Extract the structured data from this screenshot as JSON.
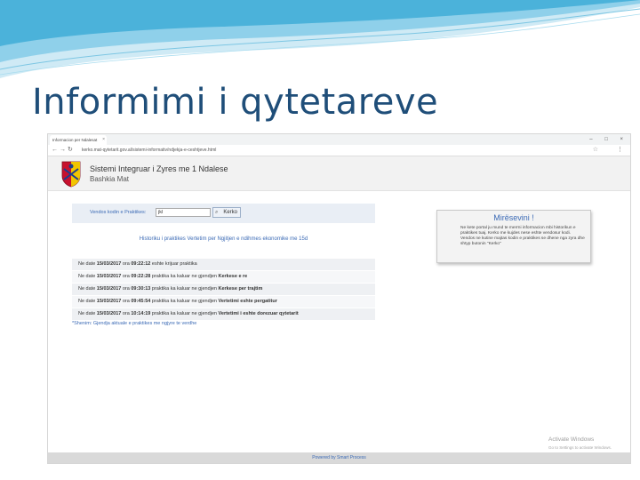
{
  "slide": {
    "title": "Informimi i qytetareve"
  },
  "browser": {
    "tab_title": "Informacion per Ndalesat",
    "tab_close": "×",
    "url": "kerko.mat-qytetarit.gov.al/sistemi-informativ/ndjekja-e-ceshtjeve.html",
    "window_controls": "– □ ×"
  },
  "site": {
    "title": "Sistemi Integruar i Zyres me 1 Ndalese",
    "subtitle": "Bashkia Mat"
  },
  "search": {
    "label": "Vendos kodin e Praktikes:",
    "value": "jkl",
    "button": "Kerko"
  },
  "results": {
    "note": "Historiku i praktikes Vertetim per Ngjitjen e ndihmes ekonomike me 15d",
    "rows": [
      {
        "prefix": "Ne date ",
        "date": "15/03/2017",
        "mid": " ora ",
        "time": "09:22:12",
        "text": " eshte krijuar praktika",
        "status": ""
      },
      {
        "prefix": "Ne date ",
        "date": "15/03/2017",
        "mid": " ora ",
        "time": "09:22:28",
        "text": " praktika ka kaluar ne gjendjen ",
        "status": "Kerkese e re"
      },
      {
        "prefix": "Ne date ",
        "date": "15/03/2017",
        "mid": " ora ",
        "time": "09:30:13",
        "text": " praktika ka kaluar ne gjendjen ",
        "status": "Kerkese per trajtim"
      },
      {
        "prefix": "Ne date ",
        "date": "15/03/2017",
        "mid": " ora ",
        "time": "09:45:54",
        "text": " praktika ka kaluar ne gjendjen ",
        "status": "Vertetimi eshte pergatitur"
      },
      {
        "prefix": "Ne date ",
        "date": "15/03/2017",
        "mid": " ora ",
        "time": "10:14:19",
        "text": " praktika ka kaluar ne gjendjen ",
        "status": "Vertetimi i eshte dorezuar qytetarit"
      }
    ],
    "footnote": "*Shenim: Gjendja aktuale e praktikes me ngjyre te verdhe"
  },
  "welcome": {
    "title": "Mirësevini !",
    "text": "Ne kete portal ju mund te merrni informacion mbi historikun e praktikes tuaj. Kerko me kujdes nese eshte vendosur kodi. Vendos ne kutine majtas kodin e praktikes se dhene nga zyra dhe shtyp butonin \"Kerko\""
  },
  "watermark": {
    "title": "Activate Windows",
    "subtitle": "Go to Settings to activate Windows."
  },
  "footer": {
    "text": "Powered by Smart Process"
  },
  "colors": {
    "accent": "#3b6ab5",
    "title": "#1f4e79",
    "panel": "#e9eef5"
  }
}
